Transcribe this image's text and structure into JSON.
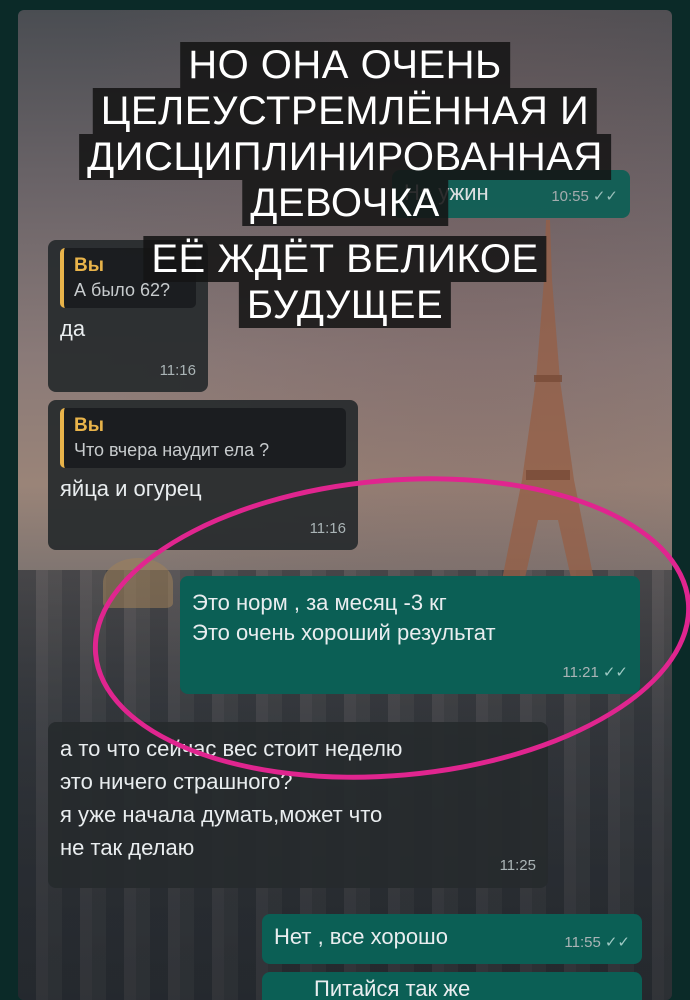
{
  "title": {
    "lines": [
      "НО ОНА ОЧЕНЬ",
      "ЦЕЛЕУСТРЕМЛЁННАЯ И",
      "ДИСЦИПЛИНИРОВАННАЯ",
      "ДЕВОЧКА",
      "ЕЁ ЖДЁТ ВЕЛИКОЕ",
      "БУДУЩЕЕ"
    ]
  },
  "messages": {
    "m0": {
      "text": "На ужин",
      "time": "10:55",
      "ticks": "✓✓"
    },
    "m1": {
      "reply_name": "Вы",
      "reply_text": "А было 62?",
      "text": "да",
      "time": "11:16"
    },
    "m2": {
      "reply_name": "Вы",
      "reply_text": "Что вчера наудит ела ?",
      "text": "яйца и огурец",
      "time": "11:16"
    },
    "m3": {
      "line1": "Это норм , за месяц -3 кг",
      "line2": "Это очень хороший результат",
      "time": "11:21",
      "ticks": "✓✓"
    },
    "m4": {
      "line1": "а то что сейчас вес стоит неделю",
      "line2": "это ничего страшного?",
      "line3": "я уже начала думать,может что",
      "line4": "не так делаю",
      "time": "11:25"
    },
    "m5": {
      "text": "Нет , все хорошо",
      "time": "11:55",
      "ticks": "✓✓"
    },
    "m6": {
      "text": "Питайся так же"
    }
  },
  "colors": {
    "highlight": "#e0258f",
    "outgoing": "#0b5f55",
    "quote_accent": "#e8b34a"
  }
}
